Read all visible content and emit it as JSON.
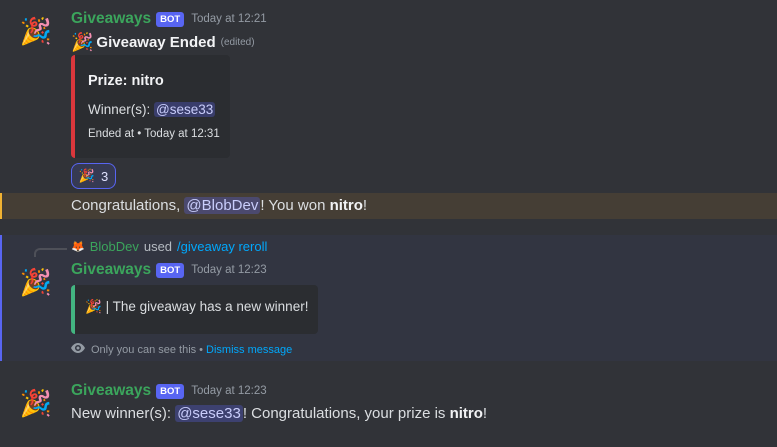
{
  "messages": [
    {
      "avatar": "party-popper",
      "username": "Giveaways",
      "bot_tag": "BOT",
      "timestamp": "Today at 12:21",
      "title_emoji": "🎉",
      "title": "Giveaway Ended",
      "edited": "(edited)",
      "embed": {
        "title": "Prize: nitro",
        "winner_label": "Winner(s):",
        "winner_mention": "@sese33",
        "footer_ended": "Ended at",
        "footer_sep": "•",
        "footer_time": "Today at 12:31",
        "border_color": "#da373c"
      },
      "reaction": {
        "emoji": "🎉",
        "count": "3"
      }
    },
    {
      "highlighted": true,
      "text_prefix": "Congratulations,",
      "mention": "@BlobDev",
      "text_middle": "! You won",
      "prize": "nitro",
      "text_suffix": "!"
    },
    {
      "ephemeral": true,
      "reply": {
        "user_emoji": "🦊",
        "user": "BlobDev",
        "used": "used",
        "command": "/giveaway reroll"
      },
      "username": "Giveaways",
      "bot_tag": "BOT",
      "timestamp": "Today at 12:23",
      "embed": {
        "emoji": "🎉",
        "text": "| The giveaway has a new winner!",
        "border_color": "#43b581"
      },
      "note": {
        "text": "Only you can see this",
        "sep": "•",
        "dismiss": "Dismiss message"
      }
    },
    {
      "username": "Giveaways",
      "bot_tag": "BOT",
      "timestamp": "Today at 12:23",
      "text_prefix": "New winner(s):",
      "mention": "@sese33",
      "text_middle": "! Congratulations, your prize is",
      "prize": "nitro",
      "text_suffix": "!"
    }
  ],
  "colors": {
    "background": "#313338",
    "username": "#3ba55c",
    "bot_tag": "#5865f2",
    "mention_bg": "rgba(88,101,242,0.3)",
    "highlight_bar": "#f0b232",
    "link": "#00a8fc"
  }
}
